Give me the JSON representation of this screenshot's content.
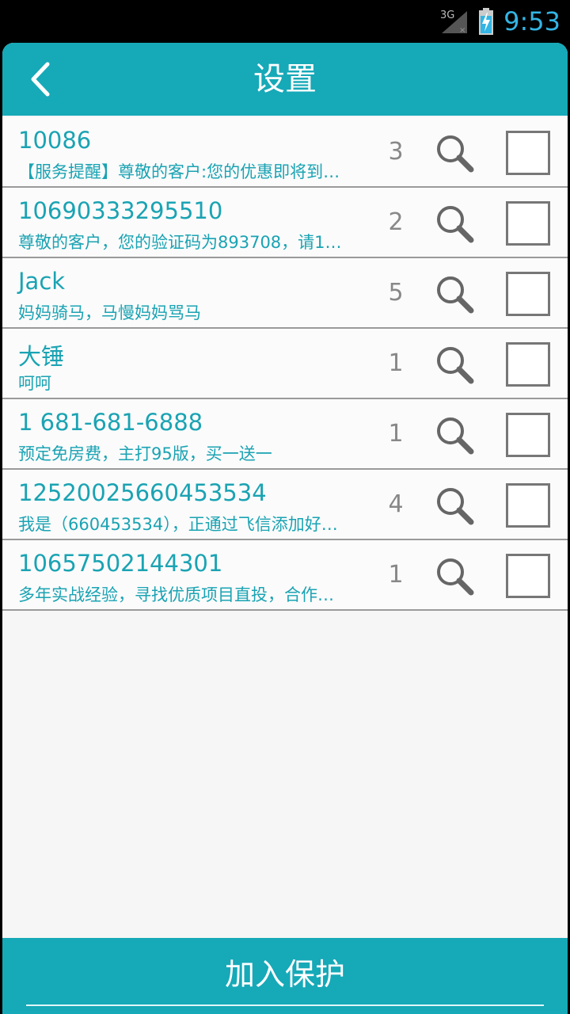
{
  "status_bar": {
    "network": "3G",
    "time": "9:53"
  },
  "header": {
    "title": "设置"
  },
  "contacts": [
    {
      "name": "10086",
      "preview": "【服务提醒】尊敬的客户:您的优惠即将到…",
      "count": "3"
    },
    {
      "name": "10690333295510",
      "preview": "尊敬的客户，您的验证码为893708，请1…",
      "count": "2"
    },
    {
      "name": "Jack",
      "preview": "妈妈骑马，马慢妈妈骂马",
      "count": "5"
    },
    {
      "name": "大锤",
      "preview": "呵呵",
      "count": "1"
    },
    {
      "name": "1 681-681-6888",
      "preview": "预定免房费，主打95版，买一送一",
      "count": "1"
    },
    {
      "name": "12520025660453534",
      "preview": "我是（660453534），正通过飞信添加好…",
      "count": "4"
    },
    {
      "name": "10657502144301",
      "preview": "多年实战经验，寻找优质项目直投，合作…",
      "count": "1"
    }
  ],
  "footer": {
    "action_label": "加入保护"
  },
  "colors": {
    "accent": "#16a9b8",
    "text_teal": "#1aa3b3",
    "count_gray": "#888888"
  }
}
